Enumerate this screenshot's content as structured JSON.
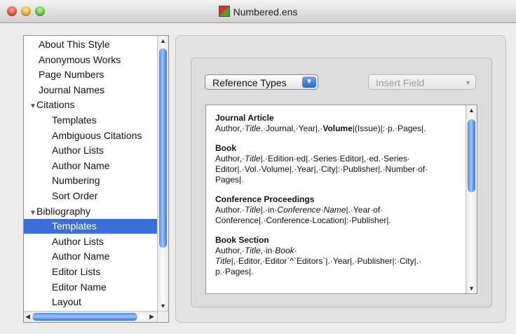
{
  "window": {
    "title": "Numbered.ens"
  },
  "sidebar": {
    "items": [
      {
        "label": "About This Style",
        "level": 0
      },
      {
        "label": "Anonymous Works",
        "level": 0
      },
      {
        "label": "Page Numbers",
        "level": 0
      },
      {
        "label": "Journal Names",
        "level": 0
      },
      {
        "label": "Citations",
        "level": 0,
        "disclosure": "▼"
      },
      {
        "label": "Templates",
        "level": 1
      },
      {
        "label": "Ambiguous Citations",
        "level": 1
      },
      {
        "label": "Author Lists",
        "level": 1
      },
      {
        "label": "Author Name",
        "level": 1
      },
      {
        "label": "Numbering",
        "level": 1
      },
      {
        "label": "Sort Order",
        "level": 1
      },
      {
        "label": "Bibliography",
        "level": 0,
        "disclosure": "▼"
      },
      {
        "label": "Templates",
        "level": 1,
        "selected": true
      },
      {
        "label": "Author Lists",
        "level": 1
      },
      {
        "label": "Author Name",
        "level": 1
      },
      {
        "label": "Editor Lists",
        "level": 1
      },
      {
        "label": "Editor Name",
        "level": 1
      },
      {
        "label": "Layout",
        "level": 1
      }
    ]
  },
  "toolbar": {
    "reference_types_label": "Reference Types",
    "insert_field_label": "Insert Field"
  },
  "templates": [
    {
      "title": "Journal Article",
      "lines": [
        [
          {
            "t": "Author,·"
          },
          {
            "t": "Title",
            "i": true
          },
          {
            "t": ".·Journal,·Year|.·"
          },
          {
            "t": "Volume",
            "b": true
          },
          {
            "t": "|(Issue)|:·p.·Pages|."
          }
        ]
      ]
    },
    {
      "title": "Book",
      "lines": [
        [
          {
            "t": "Author,·"
          },
          {
            "t": "Title",
            "i": true
          },
          {
            "t": "|.·Edition·ed|.·Series·Editor|,·ed.·Series·"
          }
        ],
        [
          {
            "t": "Editor|.·Vol.·Volume|.·Year|,·City|:·Publisher|.·Number·of·"
          }
        ],
        [
          {
            "t": "Pages|."
          }
        ]
      ]
    },
    {
      "title": "Conference Proceedings",
      "lines": [
        [
          {
            "t": "Author.·"
          },
          {
            "t": "Title",
            "i": true
          },
          {
            "t": "|.·in·"
          },
          {
            "t": "Conference·Name",
            "i": true
          },
          {
            "t": "|.·Year·of·"
          }
        ],
        [
          {
            "t": "Conference|.·Conference·Location|:·Publisher|."
          }
        ]
      ]
    },
    {
      "title": "Book Section",
      "lines": [
        [
          {
            "t": "Author,·"
          },
          {
            "t": "Title",
            "i": true
          },
          {
            "t": ",·in·"
          },
          {
            "t": "Book·",
            "i": true
          }
        ],
        [
          {
            "t": "Title",
            "i": true
          },
          {
            "t": "|,·Editor,·Editor`^`Editors`|.·Year|,·Publisher|:·City|.·"
          }
        ],
        [
          {
            "t": "p.·Pages|."
          }
        ]
      ]
    }
  ]
}
